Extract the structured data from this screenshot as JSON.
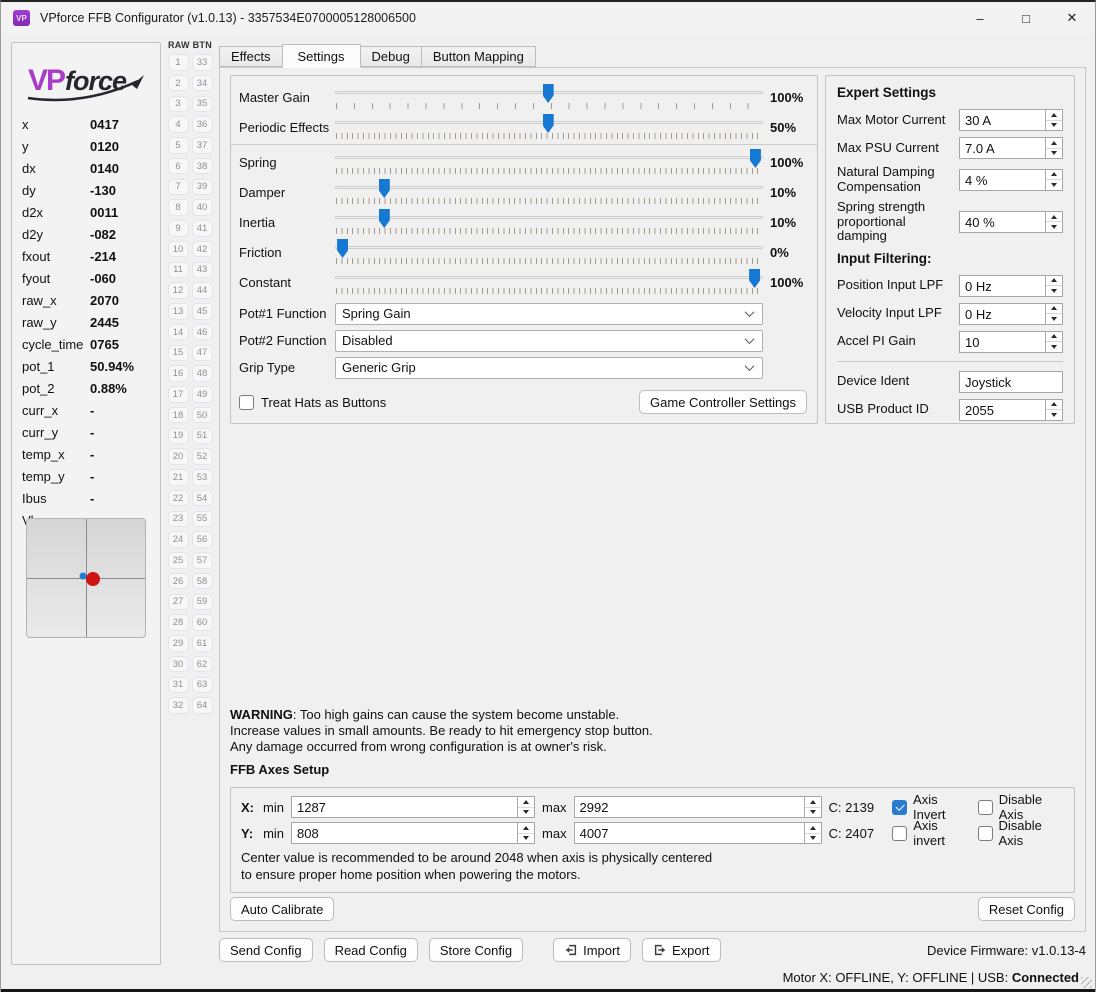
{
  "window": {
    "title": "VPforce FFB Configurator (v1.0.13) - 3357534E0700005128006500",
    "icon_text": "VP",
    "minimize": "–",
    "maximize": "□",
    "close": "✕"
  },
  "logo": {
    "vp": "VP",
    "force": "force"
  },
  "telemetry": {
    "rows": [
      {
        "label": "x",
        "value": "0417"
      },
      {
        "label": "y",
        "value": "0120"
      },
      {
        "label": "dx",
        "value": "0140"
      },
      {
        "label": "dy",
        "value": "-130"
      },
      {
        "label": "d2x",
        "value": "0011"
      },
      {
        "label": "d2y",
        "value": "-082"
      },
      {
        "label": "fxout",
        "value": "-214"
      },
      {
        "label": "fyout",
        "value": "-060"
      },
      {
        "label": "raw_x",
        "value": "2070"
      },
      {
        "label": "raw_y",
        "value": "2445"
      },
      {
        "label": "cycle_time",
        "value": "0765"
      },
      {
        "label": "pot_1",
        "value": "50.94%"
      },
      {
        "label": "pot_2",
        "value": "0.88%"
      },
      {
        "label": "curr_x",
        "value": "-"
      },
      {
        "label": "curr_y",
        "value": "-"
      },
      {
        "label": "temp_x",
        "value": "-"
      },
      {
        "label": "temp_y",
        "value": "-"
      },
      {
        "label": "Ibus",
        "value": "-"
      },
      {
        "label": "Vbus",
        "value": "-"
      }
    ]
  },
  "xy_pad": {
    "red_dot": {
      "x_pct": 55.8,
      "y_pct": 50.8
    },
    "blue_dot": {
      "x_pct": 47.3,
      "y_pct": 48.0
    }
  },
  "raw_btn": {
    "header": "RAW BTN",
    "rows": [
      [
        1,
        33
      ],
      [
        2,
        34
      ],
      [
        3,
        35
      ],
      [
        4,
        36
      ],
      [
        5,
        37
      ],
      [
        6,
        38
      ],
      [
        7,
        39
      ],
      [
        8,
        40
      ],
      [
        9,
        41
      ],
      [
        10,
        42
      ],
      [
        11,
        43
      ],
      [
        12,
        44
      ],
      [
        13,
        45
      ],
      [
        14,
        46
      ],
      [
        15,
        47
      ],
      [
        16,
        48
      ],
      [
        17,
        49
      ],
      [
        18,
        50
      ],
      [
        19,
        51
      ],
      [
        20,
        52
      ],
      [
        21,
        53
      ],
      [
        22,
        54
      ],
      [
        23,
        55
      ],
      [
        24,
        56
      ],
      [
        25,
        57
      ],
      [
        26,
        58
      ],
      [
        27,
        59
      ],
      [
        28,
        60
      ],
      [
        29,
        61
      ],
      [
        30,
        62
      ],
      [
        31,
        63
      ],
      [
        32,
        64
      ]
    ]
  },
  "tabs": {
    "items": [
      {
        "label": "Effects",
        "active": false
      },
      {
        "label": "Settings",
        "active": true
      },
      {
        "label": "Debug",
        "active": false
      },
      {
        "label": "Button Mapping",
        "active": false
      }
    ]
  },
  "sliders": {
    "gain_group": [
      {
        "label": "Master Gain",
        "value_label": "100%",
        "position_pct": 49.8,
        "tick_gap": "17.9px"
      },
      {
        "label": "Periodic Effects",
        "value_label": "50%",
        "position_pct": 49.8,
        "tick_gap": "5.4px"
      }
    ],
    "effect_group": [
      {
        "label": "Spring",
        "value_label": "100%",
        "position_pct": 99.5,
        "tick_gap": "5.4px"
      },
      {
        "label": "Damper",
        "value_label": "10%",
        "position_pct": 10.5,
        "tick_gap": "5.4px"
      },
      {
        "label": "Inertia",
        "value_label": "10%",
        "position_pct": 10.5,
        "tick_gap": "5.4px"
      },
      {
        "label": "Friction",
        "value_label": "0%",
        "position_pct": 0.5,
        "tick_gap": "5.4px"
      },
      {
        "label": "Constant",
        "value_label": "100%",
        "position_pct": 99.3,
        "tick_gap": "5.4px"
      }
    ]
  },
  "selects": {
    "items": [
      {
        "label": "Pot#1 Function",
        "value": "Spring Gain"
      },
      {
        "label": "Pot#2 Function",
        "value": "Disabled"
      },
      {
        "label": "Grip Type",
        "value": "Generic Grip"
      }
    ]
  },
  "hats_checkbox": {
    "label": "Treat Hats as Buttons",
    "checked": false
  },
  "game_controller_button": "Game Controller Settings",
  "expert": {
    "heading": "Expert Settings",
    "rows": [
      {
        "label": "Max Motor Current",
        "value": "30 A"
      },
      {
        "label": "Max PSU Current",
        "value": "7.0 A"
      },
      {
        "label": "Natural Damping Compensation",
        "value": "4 %"
      },
      {
        "label": "Spring strength proportional damping",
        "value": "40 %"
      }
    ],
    "filter_heading": "Input Filtering:",
    "filter_rows": [
      {
        "label": "Position Input LPF",
        "value": "0 Hz"
      },
      {
        "label": "Velocity Input LPF",
        "value": "0 Hz"
      },
      {
        "label": "Accel PI Gain",
        "value": "10"
      }
    ],
    "device_rows": [
      {
        "label": "Device Ident",
        "value": "Joystick",
        "no_spin": true
      },
      {
        "label": "USB Product ID",
        "value": "2055"
      }
    ]
  },
  "warning": {
    "bold": "WARNING",
    "line1": ": Too high gains can cause the system become unstable.",
    "line2": "Increase values in small amounts. Be ready to hit emergency stop button.",
    "line3": "Any damage occurred from wrong configuration is at owner's risk."
  },
  "axes": {
    "heading": "FFB Axes Setup",
    "x": {
      "axis": "X:",
      "min_label": "min",
      "min": "1287",
      "max_label": "max",
      "max": "2992",
      "c": "C:  2139",
      "invert_label": "Axis Invert",
      "invert_checked": true,
      "disable_label": "Disable Axis",
      "disable_checked": false
    },
    "y": {
      "axis": "Y:",
      "min_label": "min",
      "min": "808",
      "max_label": "max",
      "max": "4007",
      "c": "C:  2407",
      "invert_label": "Axis invert",
      "invert_checked": false,
      "disable_label": "Disable Axis",
      "disable_checked": false
    },
    "note1": "Center value is recommended to be around 2048 when axis is physically centered",
    "note2": "to ensure proper home position when powering the motors."
  },
  "actions": {
    "auto_calibrate": "Auto Calibrate",
    "reset": "Reset Config",
    "send": "Send Config",
    "read": "Read Config",
    "store": "Store Config",
    "import": "Import",
    "export": "Export",
    "firmware": "Device Firmware:  v1.0.13-4"
  },
  "status": {
    "motors": "Motor X: OFFLINE, Y: OFFLINE | USB: ",
    "usb": "Connected"
  },
  "colors": {
    "slider_blue": "#1578d2",
    "checkbox_blue": "#2a7ad0",
    "logo_purple": "#a93bc9",
    "red_dot": "#cf1212",
    "blue_dot": "#1c7fd6"
  }
}
